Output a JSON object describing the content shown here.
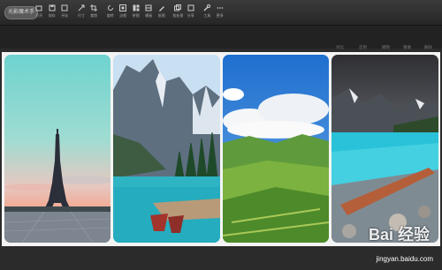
{
  "app": {
    "brand_button": "光影魔术手"
  },
  "toolbar": [
    {
      "label": "打开",
      "icon": "open-icon"
    },
    {
      "label": "保存",
      "icon": "save-icon"
    },
    {
      "label": "另存",
      "icon": "save-as-icon"
    },
    {
      "label": "尺寸",
      "icon": "resize-icon"
    },
    {
      "label": "裁剪",
      "icon": "crop-icon"
    },
    {
      "label": "旋转",
      "icon": "rotate-icon"
    },
    {
      "label": "边框",
      "icon": "border-icon"
    },
    {
      "label": "拼图",
      "icon": "collage-icon"
    },
    {
      "label": "模板",
      "icon": "template-icon"
    },
    {
      "label": "抠图",
      "icon": "cutout-icon"
    },
    {
      "label": "批处理",
      "icon": "batch-icon"
    },
    {
      "label": "分享",
      "icon": "share-icon"
    },
    {
      "label": "工具",
      "icon": "tools-icon"
    },
    {
      "label": "更多",
      "icon": "more-icon"
    }
  ],
  "sub_actions": [
    {
      "label": "对比"
    },
    {
      "label": "还原"
    },
    {
      "label": "撤销"
    },
    {
      "label": "重做"
    },
    {
      "label": "删除"
    }
  ],
  "watermark": {
    "brand": "Bai 经验",
    "url": "jingyan.baidu.com"
  }
}
